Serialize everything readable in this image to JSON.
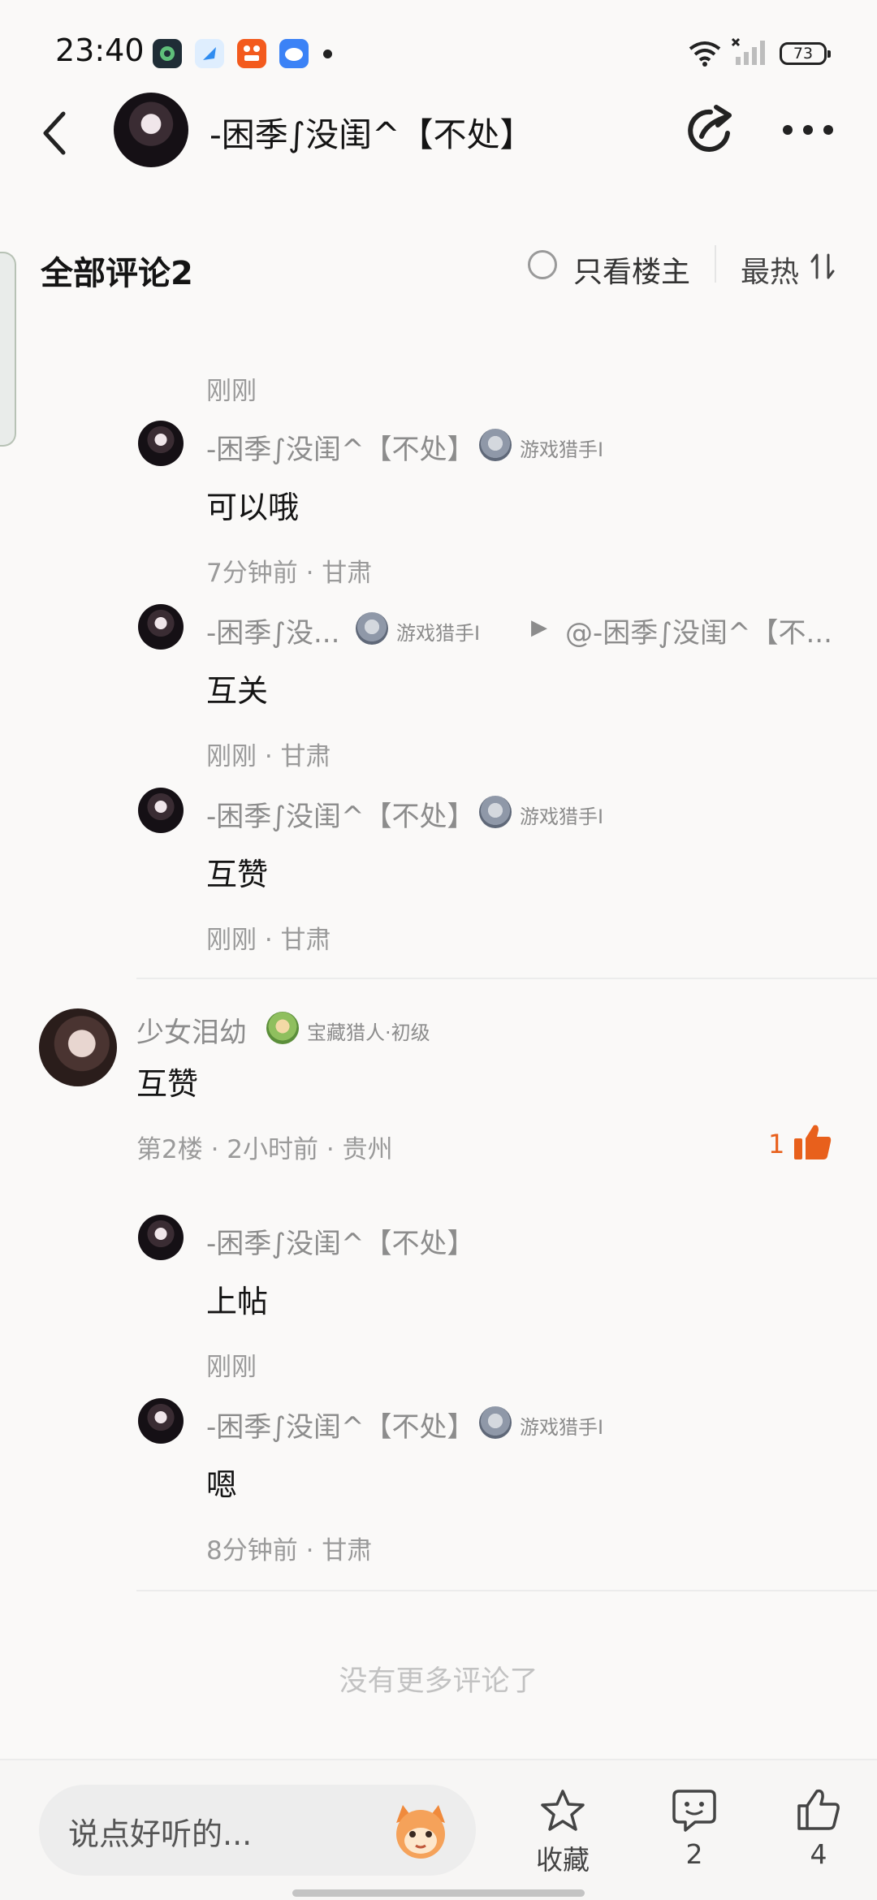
{
  "status_bar": {
    "time": "23:40",
    "battery": "73",
    "app_icons": [
      "app-icon-1",
      "app-icon-2",
      "app-icon-3",
      "app-icon-4"
    ]
  },
  "header": {
    "title": "-困季∫没闺^【不处】"
  },
  "comments_header": {
    "title": "全部评论2",
    "only_op_label": "只看楼主",
    "sort_label": "最热"
  },
  "partial_top": {
    "time": "刚刚"
  },
  "replies_a": [
    {
      "name": "-困季∫没闺^【不处】",
      "badge": "游戏猎手I",
      "text": "可以哦",
      "meta": "7分钟前 · 甘肃"
    },
    {
      "name": "-困季∫没...",
      "badge": "游戏猎手I",
      "reply_to": "@-困季∫没闺^【不...",
      "text": "互关",
      "meta": "刚刚 · 甘肃"
    },
    {
      "name": "-困季∫没闺^【不处】",
      "badge": "游戏猎手I",
      "text": "互赞",
      "meta": "刚刚 · 甘肃"
    }
  ],
  "floor2": {
    "name": "少女泪幼",
    "badge": "宝藏猎人·初级",
    "text": "互赞",
    "meta": "第2楼 · 2小时前 · 贵州",
    "likes": "1"
  },
  "replies_b": [
    {
      "name": "-困季∫没闺^【不处】",
      "text": "上帖",
      "meta": "刚刚"
    },
    {
      "name": "-困季∫没闺^【不处】",
      "badge": "游戏猎手I",
      "text": "嗯",
      "meta": "8分钟前 · 甘肃"
    }
  ],
  "footer_text": "没有更多评论了",
  "bottom_bar": {
    "input_placeholder": "说点好听的...",
    "favorite_label": "收藏",
    "comment_count": "2",
    "like_count": "4"
  },
  "colors": {
    "accent_orange": "#e8601c",
    "text_gray": "#8c8c8c"
  }
}
